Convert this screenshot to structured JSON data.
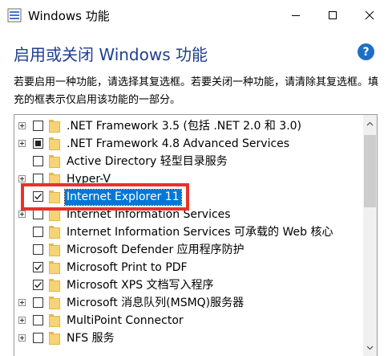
{
  "window": {
    "title": "Windows 功能",
    "icon": "windows-features-icon",
    "controls": [
      "minimize-icon",
      "maximize-icon",
      "close-icon"
    ]
  },
  "header": {
    "heading": "启用或关闭 Windows 功能",
    "help_icon": "?"
  },
  "description": "若要启用一种功能，请选择其复选框。若要关闭一种功能，请清除其复选框。填充的框表示仅启用该功能的一部分。",
  "features": [
    {
      "label": ".NET Framework 3.5 (包括 .NET 2.0 和 3.0)",
      "expandable": true,
      "state": "unchecked"
    },
    {
      "label": ".NET Framework 4.8 Advanced Services",
      "expandable": true,
      "state": "partial"
    },
    {
      "label": "Active Directory 轻型目录服务",
      "expandable": false,
      "state": "unchecked"
    },
    {
      "label": "Hyper-V",
      "expandable": true,
      "state": "unchecked"
    },
    {
      "label": "Internet Explorer 11",
      "expandable": false,
      "state": "checked",
      "selected": true
    },
    {
      "label": "Internet Information Services",
      "expandable": true,
      "state": "unchecked"
    },
    {
      "label": "Internet Information Services 可承载的 Web 核心",
      "expandable": false,
      "state": "unchecked"
    },
    {
      "label": "Microsoft Defender 应用程序防护",
      "expandable": false,
      "state": "unchecked"
    },
    {
      "label": "Microsoft Print to PDF",
      "expandable": false,
      "state": "checked"
    },
    {
      "label": "Microsoft XPS 文档写入程序",
      "expandable": false,
      "state": "checked"
    },
    {
      "label": "Microsoft 消息队列(MSMQ)服务器",
      "expandable": true,
      "state": "unchecked"
    },
    {
      "label": "MultiPoint Connector",
      "expandable": true,
      "state": "unchecked"
    },
    {
      "label": "NFS 服务",
      "expandable": true,
      "state": "unchecked"
    }
  ],
  "colors": {
    "heading": "#1f3f8f",
    "selection": "#0078d7",
    "highlight": "#e8322d"
  }
}
